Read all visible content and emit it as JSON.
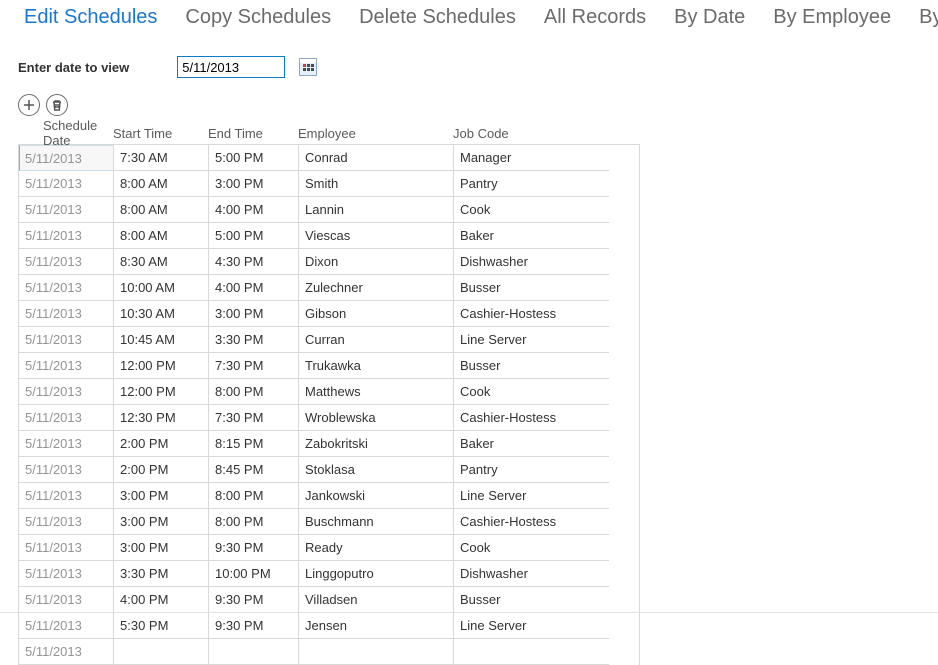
{
  "tabs": [
    {
      "label": "Edit Schedules",
      "active": true
    },
    {
      "label": "Copy Schedules",
      "active": false
    },
    {
      "label": "Delete Schedules",
      "active": false
    },
    {
      "label": "All Records",
      "active": false
    },
    {
      "label": "By Date",
      "active": false
    },
    {
      "label": "By Employee",
      "active": false
    },
    {
      "label": "By Position",
      "active": false
    }
  ],
  "filter": {
    "label": "Enter date to view",
    "date_value": "5/11/2013"
  },
  "grid": {
    "headers": {
      "schedule_date": "Schedule Date",
      "start_time": "Start Time",
      "end_time": "End Time",
      "employee": "Employee",
      "job_code": "Job Code"
    },
    "rows": [
      {
        "schedule_date": "5/11/2013",
        "start_time": "7:30 AM",
        "end_time": "5:00 PM",
        "employee": "Conrad",
        "job_code": "Manager",
        "selected": true
      },
      {
        "schedule_date": "5/11/2013",
        "start_time": "8:00 AM",
        "end_time": "3:00 PM",
        "employee": "Smith",
        "job_code": "Pantry"
      },
      {
        "schedule_date": "5/11/2013",
        "start_time": "8:00 AM",
        "end_time": "4:00 PM",
        "employee": "Lannin",
        "job_code": "Cook"
      },
      {
        "schedule_date": "5/11/2013",
        "start_time": "8:00 AM",
        "end_time": "5:00 PM",
        "employee": "Viescas",
        "job_code": "Baker"
      },
      {
        "schedule_date": "5/11/2013",
        "start_time": "8:30 AM",
        "end_time": "4:30 PM",
        "employee": "Dixon",
        "job_code": "Dishwasher"
      },
      {
        "schedule_date": "5/11/2013",
        "start_time": "10:00 AM",
        "end_time": "4:00 PM",
        "employee": "Zulechner",
        "job_code": "Busser"
      },
      {
        "schedule_date": "5/11/2013",
        "start_time": "10:30 AM",
        "end_time": "3:00 PM",
        "employee": "Gibson",
        "job_code": "Cashier-Hostess"
      },
      {
        "schedule_date": "5/11/2013",
        "start_time": "10:45 AM",
        "end_time": "3:30 PM",
        "employee": "Curran",
        "job_code": "Line Server"
      },
      {
        "schedule_date": "5/11/2013",
        "start_time": "12:00 PM",
        "end_time": "7:30 PM",
        "employee": "Trukawka",
        "job_code": "Busser"
      },
      {
        "schedule_date": "5/11/2013",
        "start_time": "12:00 PM",
        "end_time": "8:00 PM",
        "employee": "Matthews",
        "job_code": "Cook"
      },
      {
        "schedule_date": "5/11/2013",
        "start_time": "12:30 PM",
        "end_time": "7:30 PM",
        "employee": "Wroblewska",
        "job_code": "Cashier-Hostess"
      },
      {
        "schedule_date": "5/11/2013",
        "start_time": "2:00 PM",
        "end_time": "8:15 PM",
        "employee": "Zabokritski",
        "job_code": "Baker"
      },
      {
        "schedule_date": "5/11/2013",
        "start_time": "2:00 PM",
        "end_time": "8:45 PM",
        "employee": "Stoklasa",
        "job_code": "Pantry"
      },
      {
        "schedule_date": "5/11/2013",
        "start_time": "3:00 PM",
        "end_time": "8:00 PM",
        "employee": "Jankowski",
        "job_code": "Line Server"
      },
      {
        "schedule_date": "5/11/2013",
        "start_time": "3:00 PM",
        "end_time": "8:00 PM",
        "employee": "Buschmann",
        "job_code": "Cashier-Hostess"
      },
      {
        "schedule_date": "5/11/2013",
        "start_time": "3:00 PM",
        "end_time": "9:30 PM",
        "employee": "Ready",
        "job_code": "Cook"
      },
      {
        "schedule_date": "5/11/2013",
        "start_time": "3:30 PM",
        "end_time": "10:00 PM",
        "employee": "Linggoputro",
        "job_code": "Dishwasher"
      },
      {
        "schedule_date": "5/11/2013",
        "start_time": "4:00 PM",
        "end_time": "9:30 PM",
        "employee": "Villadsen",
        "job_code": "Busser"
      },
      {
        "schedule_date": "5/11/2013",
        "start_time": "5:30 PM",
        "end_time": "9:30 PM",
        "employee": "Jensen",
        "job_code": "Line Server"
      },
      {
        "schedule_date": "5/11/2013",
        "start_time": "",
        "end_time": "",
        "employee": "",
        "job_code": ""
      }
    ]
  }
}
